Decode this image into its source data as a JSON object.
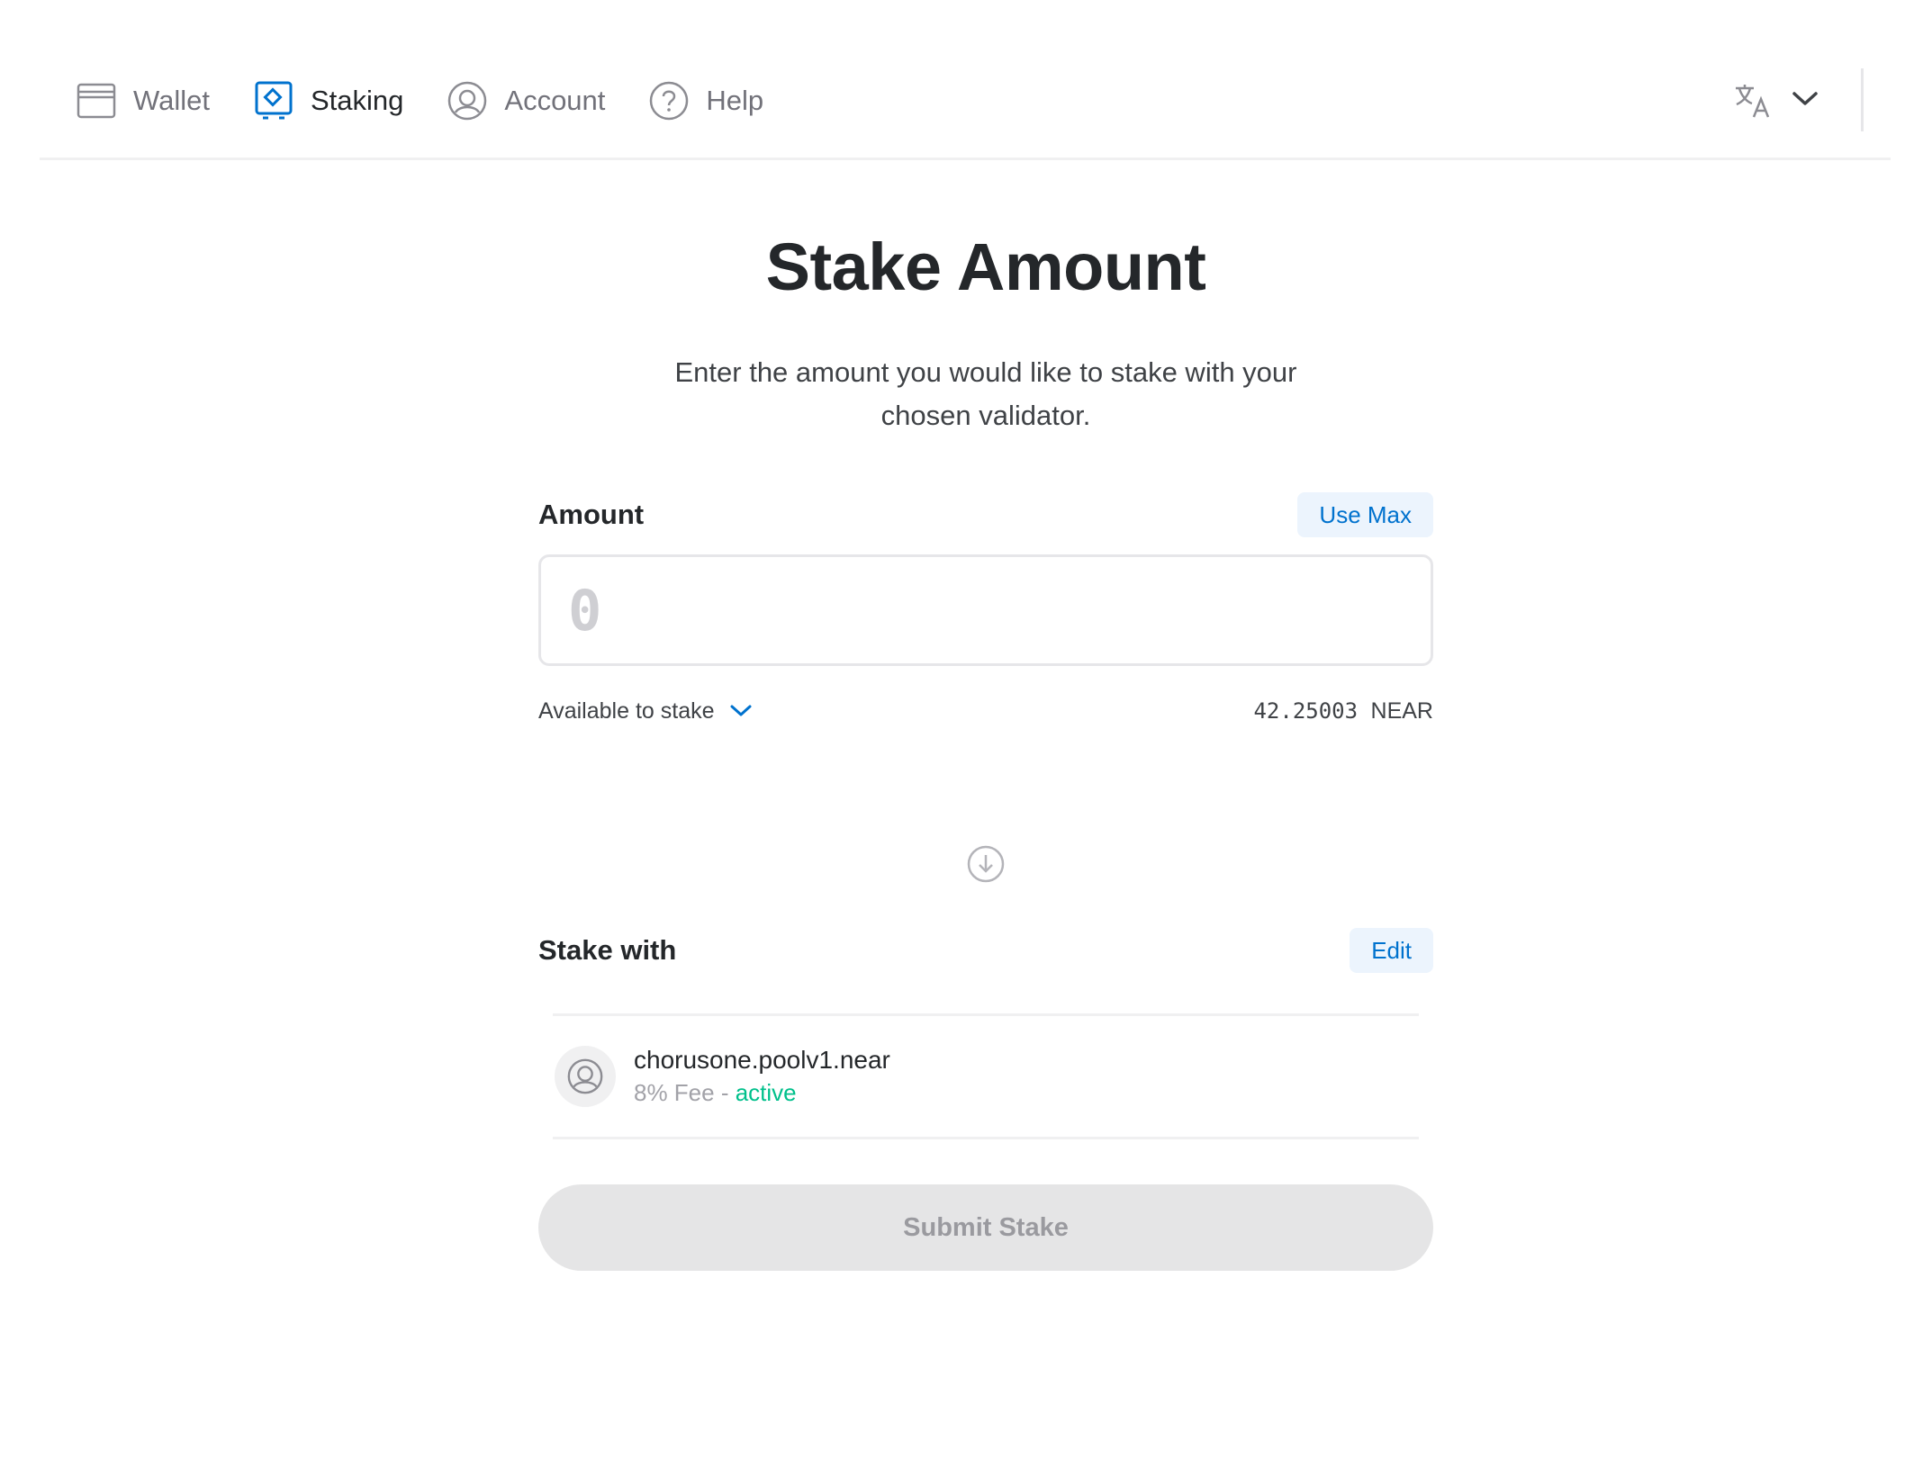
{
  "nav": {
    "items": [
      {
        "label": "Wallet",
        "icon": "wallet-icon",
        "active": false
      },
      {
        "label": "Staking",
        "icon": "staking-icon",
        "active": true
      },
      {
        "label": "Account",
        "icon": "account-icon",
        "active": false
      },
      {
        "label": "Help",
        "icon": "help-icon",
        "active": false
      }
    ],
    "language_icon": "translate-icon"
  },
  "page": {
    "title": "Stake Amount",
    "description": "Enter the amount you would like to stake with your chosen validator."
  },
  "amount": {
    "label": "Amount",
    "use_max_label": "Use Max",
    "placeholder": "0",
    "value": ""
  },
  "available": {
    "label": "Available to stake",
    "value": "42.25003",
    "unit": "NEAR"
  },
  "stake_with": {
    "label": "Stake with",
    "edit_label": "Edit",
    "validator": {
      "name": "chorusone.poolv1.near",
      "fee": "8% Fee",
      "separator": " - ",
      "status": "active"
    }
  },
  "submit": {
    "label": "Submit Stake",
    "disabled": true
  },
  "colors": {
    "accent": "#0072ce",
    "active_status": "#00c08b",
    "disabled_bg": "#e5e5e6"
  }
}
